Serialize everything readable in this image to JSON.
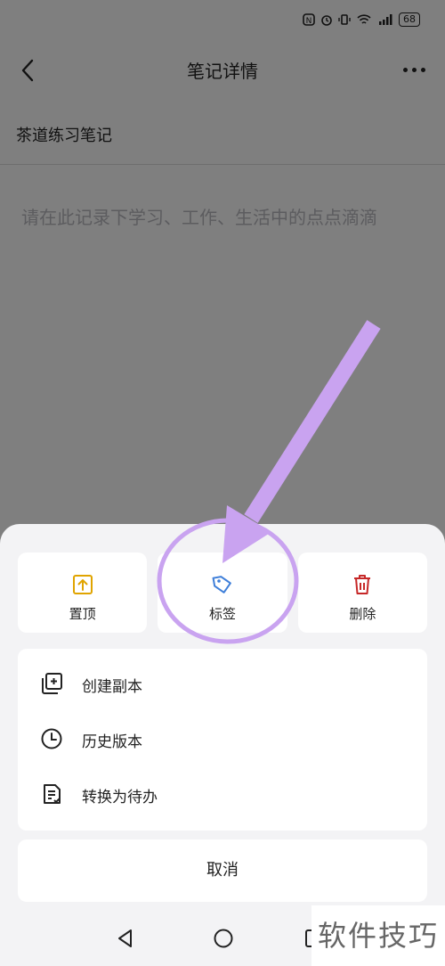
{
  "status_bar": {
    "icons": [
      "nfc-icon",
      "alarm-icon",
      "vibrate-icon",
      "wifi-icon",
      "signal-icon"
    ],
    "battery": "68"
  },
  "header": {
    "title": "笔记详情",
    "back_icon": "chevron-left-icon",
    "more_icon": "more-dots-icon"
  },
  "note": {
    "title": "茶道练习笔记",
    "placeholder": "请在此记录下学习、工作、生活中的点点滴滴"
  },
  "sheet": {
    "actions": [
      {
        "label": "置顶",
        "icon": "pin-top-icon",
        "color": "#E0A400"
      },
      {
        "label": "标签",
        "icon": "tag-icon",
        "color": "#3F7FD9"
      },
      {
        "label": "删除",
        "icon": "trash-icon",
        "color": "#C62828"
      }
    ],
    "menu": [
      {
        "label": "创建副本",
        "icon": "copy-icon"
      },
      {
        "label": "历史版本",
        "icon": "clock-icon"
      },
      {
        "label": "转换为待办",
        "icon": "todo-list-icon"
      }
    ],
    "cancel": "取消"
  },
  "system_nav": {
    "back": "triangle-back-icon",
    "home": "circle-home-icon",
    "recents": "recents-icon"
  },
  "watermark": "软件技巧",
  "annotation": {
    "color": "#C9A3F0"
  }
}
